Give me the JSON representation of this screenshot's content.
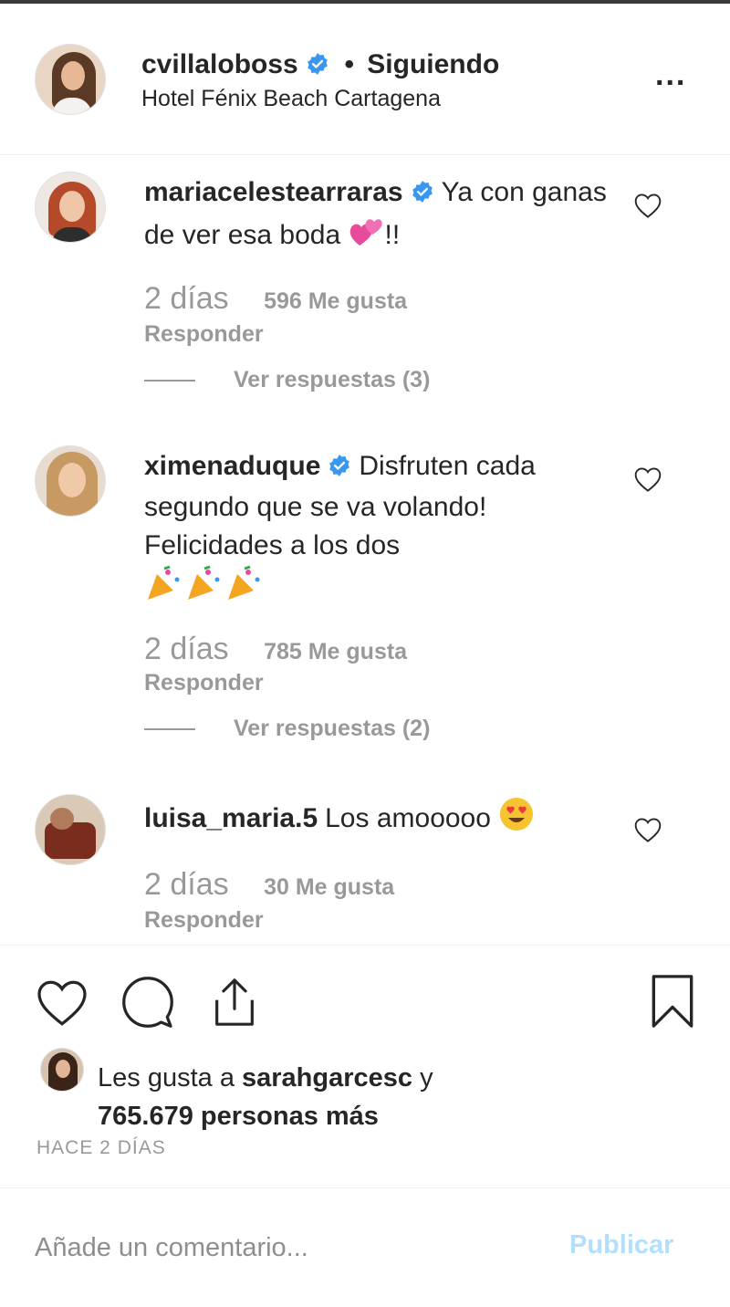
{
  "post": {
    "username": "cvillaloboss",
    "separator": "•",
    "follow_status": "Siguiendo",
    "location": "Hotel Fénix Beach Cartagena",
    "more_label": "..."
  },
  "comments": [
    {
      "username": "mariacelestearraras",
      "verified": true,
      "text": "Ya con ganas de ver esa boda",
      "text_suffix": "!!",
      "emoji": "two-hearts",
      "time": "2 días",
      "likes": "596 Me gusta",
      "reply": "Responder",
      "view_replies": "Ver respuestas (3)"
    },
    {
      "username": "ximenaduque",
      "verified": true,
      "text": "Disfruten cada segundo que se va volando! Felicidades a los dos",
      "emoji": "party-popper x3",
      "time": "2 días",
      "likes": "785 Me gusta",
      "reply": "Responder",
      "view_replies": "Ver respuestas (2)"
    },
    {
      "username": "luisa_maria.5",
      "verified": false,
      "text": "Los amooooo",
      "emoji": "heart-eyes",
      "time": "2 días",
      "likes": "30 Me gusta",
      "reply": "Responder"
    }
  ],
  "likes": {
    "prefix": "Les gusta a",
    "user": "sarahgarcesc",
    "joiner": "y",
    "others": "765.679 personas más"
  },
  "timestamp": "HACE 2 DÍAS",
  "composer": {
    "placeholder": "Añade un comentario...",
    "publish_label": "Publicar"
  },
  "colors": {
    "verified_blue": "#3897f0",
    "muted_text": "#999999",
    "publish_disabled": "#b2dffc"
  },
  "icons": [
    "more-options-icon",
    "verified-badge-icon",
    "heart-icon",
    "comment-icon",
    "share-icon",
    "bookmark-icon"
  ]
}
